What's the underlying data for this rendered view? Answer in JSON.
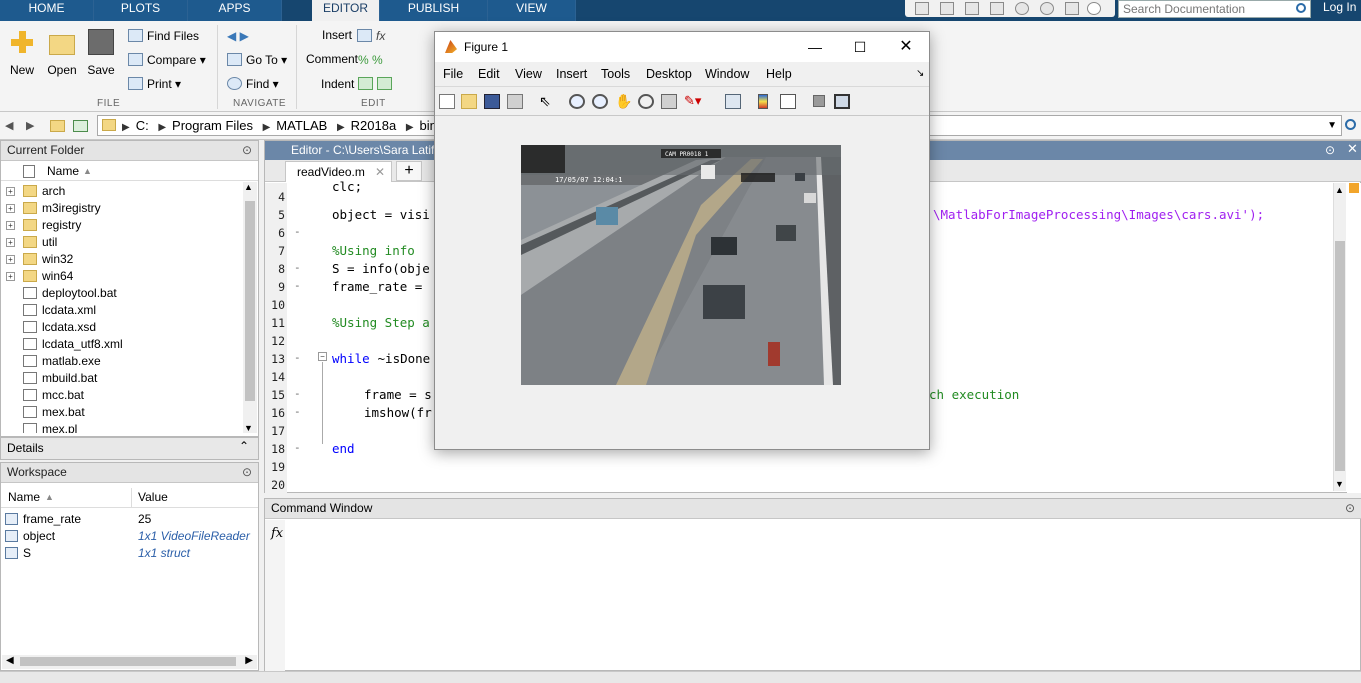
{
  "tabs": [
    "HOME",
    "PLOTS",
    "APPS",
    "EDITOR",
    "PUBLISH",
    "VIEW"
  ],
  "active_tab": "EDITOR",
  "search_placeholder": "Search Documentation",
  "login": "Log In",
  "ribbon": {
    "file": {
      "new": "New",
      "open": "Open",
      "save": "Save",
      "find_files": "Find Files",
      "compare": "Compare",
      "print": "Print",
      "section": "FILE"
    },
    "navigate": {
      "go_to": "Go To",
      "find": "Find",
      "section": "NAVIGATE"
    },
    "edit": {
      "insert": "Insert",
      "comment": "Comment",
      "indent": "Indent",
      "section": "EDIT"
    }
  },
  "path": [
    "C:",
    "Program Files",
    "MATLAB",
    "R2018a",
    "bin"
  ],
  "current_folder": {
    "title": "Current Folder",
    "col_name": "Name",
    "items": [
      {
        "name": "arch",
        "type": "folder"
      },
      {
        "name": "m3iregistry",
        "type": "folder"
      },
      {
        "name": "registry",
        "type": "folder"
      },
      {
        "name": "util",
        "type": "folder"
      },
      {
        "name": "win32",
        "type": "folder"
      },
      {
        "name": "win64",
        "type": "folder"
      },
      {
        "name": "deploytool.bat",
        "type": "file"
      },
      {
        "name": "lcdata.xml",
        "type": "file"
      },
      {
        "name": "lcdata.xsd",
        "type": "file"
      },
      {
        "name": "lcdata_utf8.xml",
        "type": "file"
      },
      {
        "name": "matlab.exe",
        "type": "file"
      },
      {
        "name": "mbuild.bat",
        "type": "file"
      },
      {
        "name": "mcc.bat",
        "type": "file"
      },
      {
        "name": "mex.bat",
        "type": "file"
      },
      {
        "name": "mex.pl",
        "type": "file"
      }
    ]
  },
  "details": "Details",
  "workspace": {
    "title": "Workspace",
    "col_name": "Name",
    "col_value": "Value",
    "vars": [
      {
        "name": "frame_rate",
        "value": "25"
      },
      {
        "name": "object",
        "value": "1x1 VideoFileReader"
      },
      {
        "name": "S",
        "value": "1x1 struct"
      }
    ]
  },
  "editor": {
    "title": "Editor - C:\\Users\\Sara Latif I",
    "tab": "readVideo.m",
    "lines": [
      "4",
      "5",
      "6",
      "7",
      "8",
      "9",
      "10",
      "11",
      "12",
      "13",
      "14",
      "15",
      "16",
      "17",
      "18",
      "19",
      "20"
    ],
    "code": {
      "l5": "object = visi",
      "l5_right": "\\MatlabForImageProcessing\\Images\\cars.avi');",
      "l7": "%Using info",
      "l8": "S = info(obje",
      "l9": "frame_rate =",
      "l11": "%Using Step a",
      "l13_kw": "while",
      "l13": " ~isDone",
      "l15": "frame = s",
      "l15_right": "ch execution",
      "l16": "imshow(fr",
      "l18": "end"
    }
  },
  "command_window": {
    "title": "Command Window",
    "prompt": "fx"
  },
  "figure": {
    "title": "Figure 1",
    "menu": [
      "File",
      "Edit",
      "View",
      "Insert",
      "Tools",
      "Desktop",
      "Window",
      "Help"
    ],
    "overlay_text": "17/05/07 12:04:1",
    "overlay_text2": "CAM PR0018 1"
  }
}
